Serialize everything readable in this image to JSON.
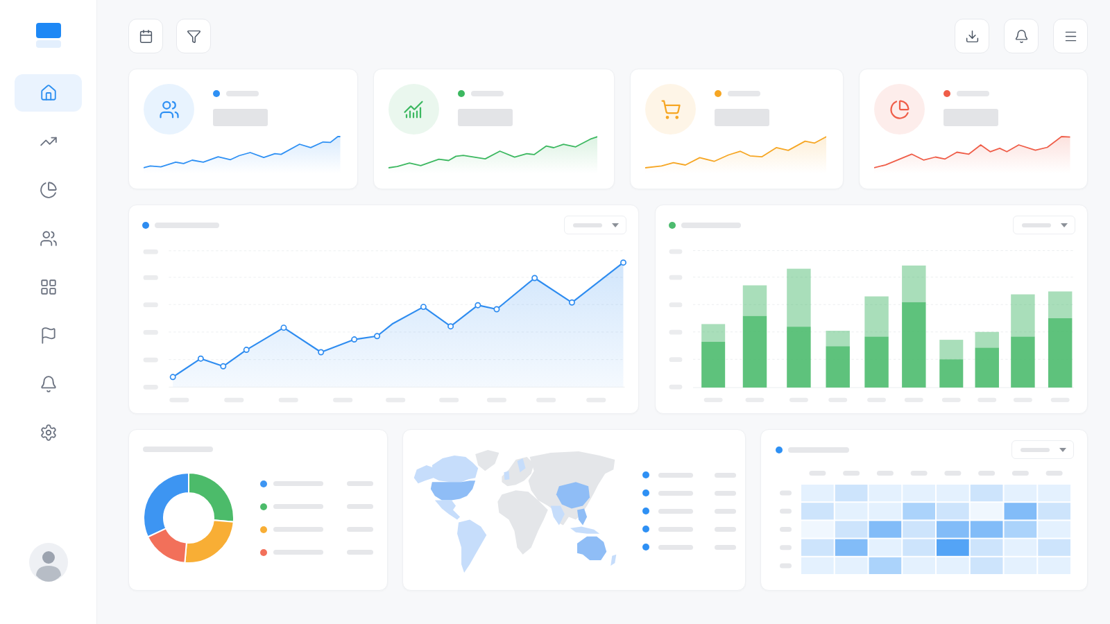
{
  "sidebar": {
    "items": [
      {
        "selected": true
      },
      {
        "selected": false
      },
      {
        "selected": false
      },
      {
        "selected": false
      },
      {
        "selected": false
      },
      {
        "selected": false
      },
      {
        "selected": false
      },
      {
        "selected": false
      }
    ]
  },
  "stat_cards": [
    {
      "color": "#2e90f4"
    },
    {
      "color": "#3cb860"
    },
    {
      "color": "#f6a623"
    },
    {
      "color": "#ef5d48"
    }
  ],
  "charts": [
    {
      "kind": "line",
      "color": "#2e8cf0"
    },
    {
      "kind": "bar",
      "color": "#4cbb6e"
    }
  ],
  "widgets": [
    {
      "kind": "donut",
      "legend": [
        {
          "color": "#3d95f2"
        },
        {
          "color": "#4cbb6a"
        },
        {
          "color": "#f8ae35"
        },
        {
          "color": "#f2705a"
        }
      ]
    },
    {
      "kind": "map"
    },
    {
      "kind": "heatmap",
      "color": "#2e90f4"
    }
  ]
}
